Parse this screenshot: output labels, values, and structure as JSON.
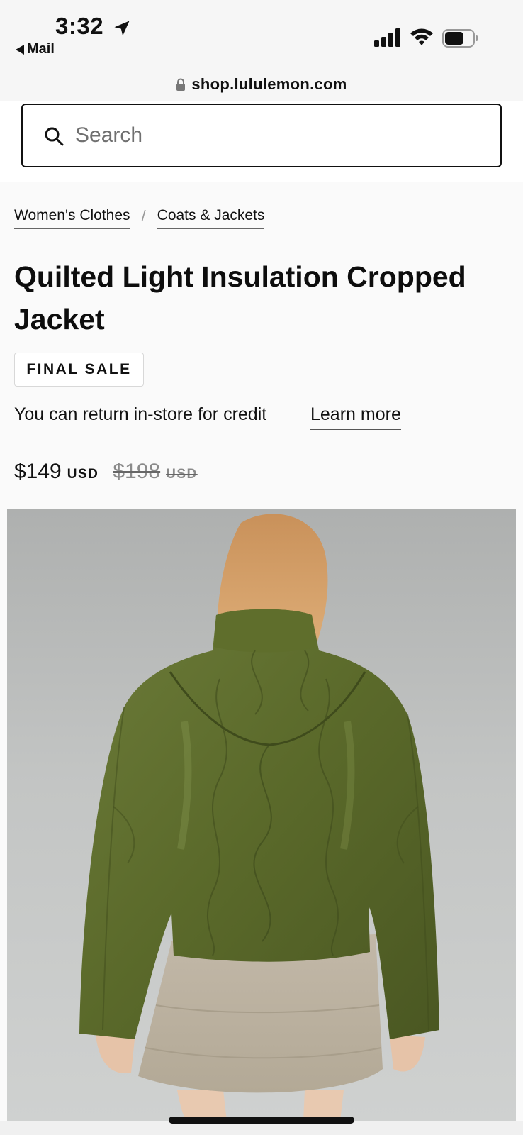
{
  "status_bar": {
    "time": "3:32",
    "back_app": "Mail",
    "location_icon": "location-arrow-icon",
    "signal_icon": "cellular-signal-icon",
    "wifi_icon": "wifi-icon",
    "battery_icon": "battery-icon"
  },
  "browser": {
    "url": "shop.lululemon.com",
    "lock_icon": "lock-icon"
  },
  "search": {
    "placeholder": "Search",
    "icon": "search-icon"
  },
  "breadcrumb": {
    "items": [
      {
        "label": "Women's Clothes"
      },
      {
        "label": "Coats & Jackets"
      }
    ],
    "separator": "/"
  },
  "product": {
    "title": "Quilted Light Insulation Cropped Jacket",
    "badge": "FINAL SALE",
    "return_text": "You can return in-store for credit",
    "learn_more": "Learn more",
    "price": "$149",
    "price_currency": "USD",
    "original_price": "$198",
    "original_currency": "USD"
  },
  "colors": {
    "accent": "#111111",
    "jacket": "#5c6b2e",
    "background": "#fafafa"
  }
}
